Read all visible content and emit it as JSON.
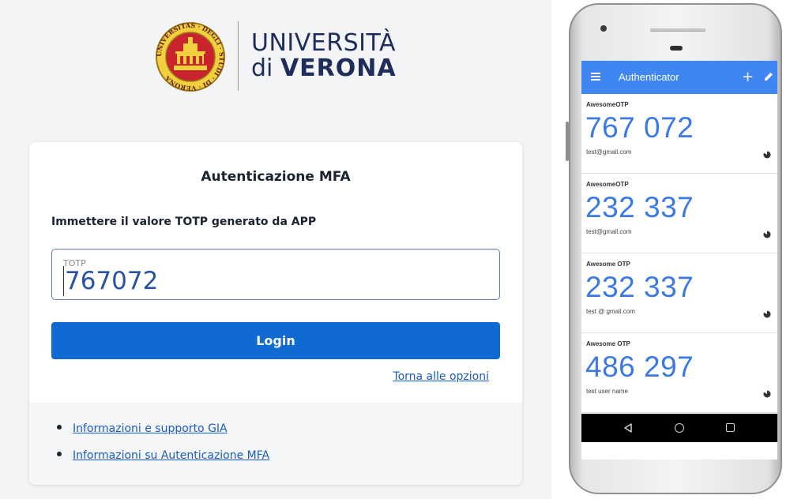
{
  "university": {
    "name_line1": "UNIVERSITÀ",
    "name_line2_prefix": "di",
    "name_line2_bold": "VERONA",
    "seal_text": "UNIVERSITAS · DEGLI · STUDI · DI · VERONA"
  },
  "login": {
    "title": "Autenticazione MFA",
    "instruction": "Immettere il valore TOTP generato da APP",
    "totp_label": "TOTP",
    "totp_value": "767072",
    "login_button": "Login",
    "back_link": "Torna alle opzioni",
    "footer_links": [
      "Informazioni e supporto GIA",
      "Informazioni su Autenticazione MFA"
    ],
    "colors": {
      "primary": "#0f6ad1",
      "link": "#1a5cc4",
      "background": "#f3f4f5"
    }
  },
  "phone": {
    "app_title": "Authenticator",
    "add_icon": "+",
    "accounts": [
      {
        "issuer": "AwesomeOTP",
        "code": "767 072",
        "user": "test@gmail.com"
      },
      {
        "issuer": "AwesomeOTP",
        "code": "232 337",
        "user": "test@gmail.com"
      },
      {
        "issuer": "Awesome OTP",
        "code": "232 337",
        "user": "test @ gmail.com"
      },
      {
        "issuer": "Awesome OTP",
        "code": "486 297",
        "user": "test user name"
      }
    ],
    "icons": [
      "menu-icon",
      "add-icon",
      "edit-icon",
      "timer-icon",
      "nav-back-icon",
      "nav-home-icon",
      "nav-recent-icon"
    ],
    "colors": {
      "app_bar": "#3f86f3",
      "code": "#3b79e4"
    }
  }
}
